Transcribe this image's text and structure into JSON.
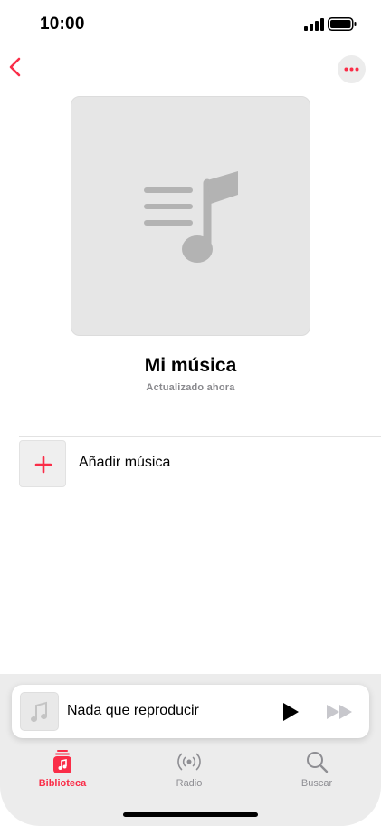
{
  "status_bar": {
    "time": "10:00",
    "icons": [
      "signal-icon",
      "battery-icon"
    ]
  },
  "header": {
    "back_icon": "chevron-left-icon",
    "more_icon": "ellipsis-icon"
  },
  "playlist": {
    "artwork_icon": "music-note-list-icon",
    "title": "Mi música",
    "subtitle": "Actualizado ahora"
  },
  "actions": {
    "add_music_label": "Añadir música",
    "add_icon": "plus-icon"
  },
  "mini_player": {
    "title": "Nada que reproducir",
    "artwork_icon": "music-note-icon",
    "play_icon": "play-icon",
    "forward_icon": "fast-forward-icon"
  },
  "tabs": [
    {
      "label": "Biblioteca",
      "icon": "library-icon",
      "selected": true
    },
    {
      "label": "Radio",
      "icon": "radio-icon",
      "selected": false
    },
    {
      "label": "Buscar",
      "icon": "search-icon",
      "selected": false
    }
  ],
  "colors": {
    "accent": "#fa2d48",
    "inactive": "#8e8e93",
    "artwork_bg": "#e6e6e6",
    "tab_bar_bg": "#ececec"
  }
}
